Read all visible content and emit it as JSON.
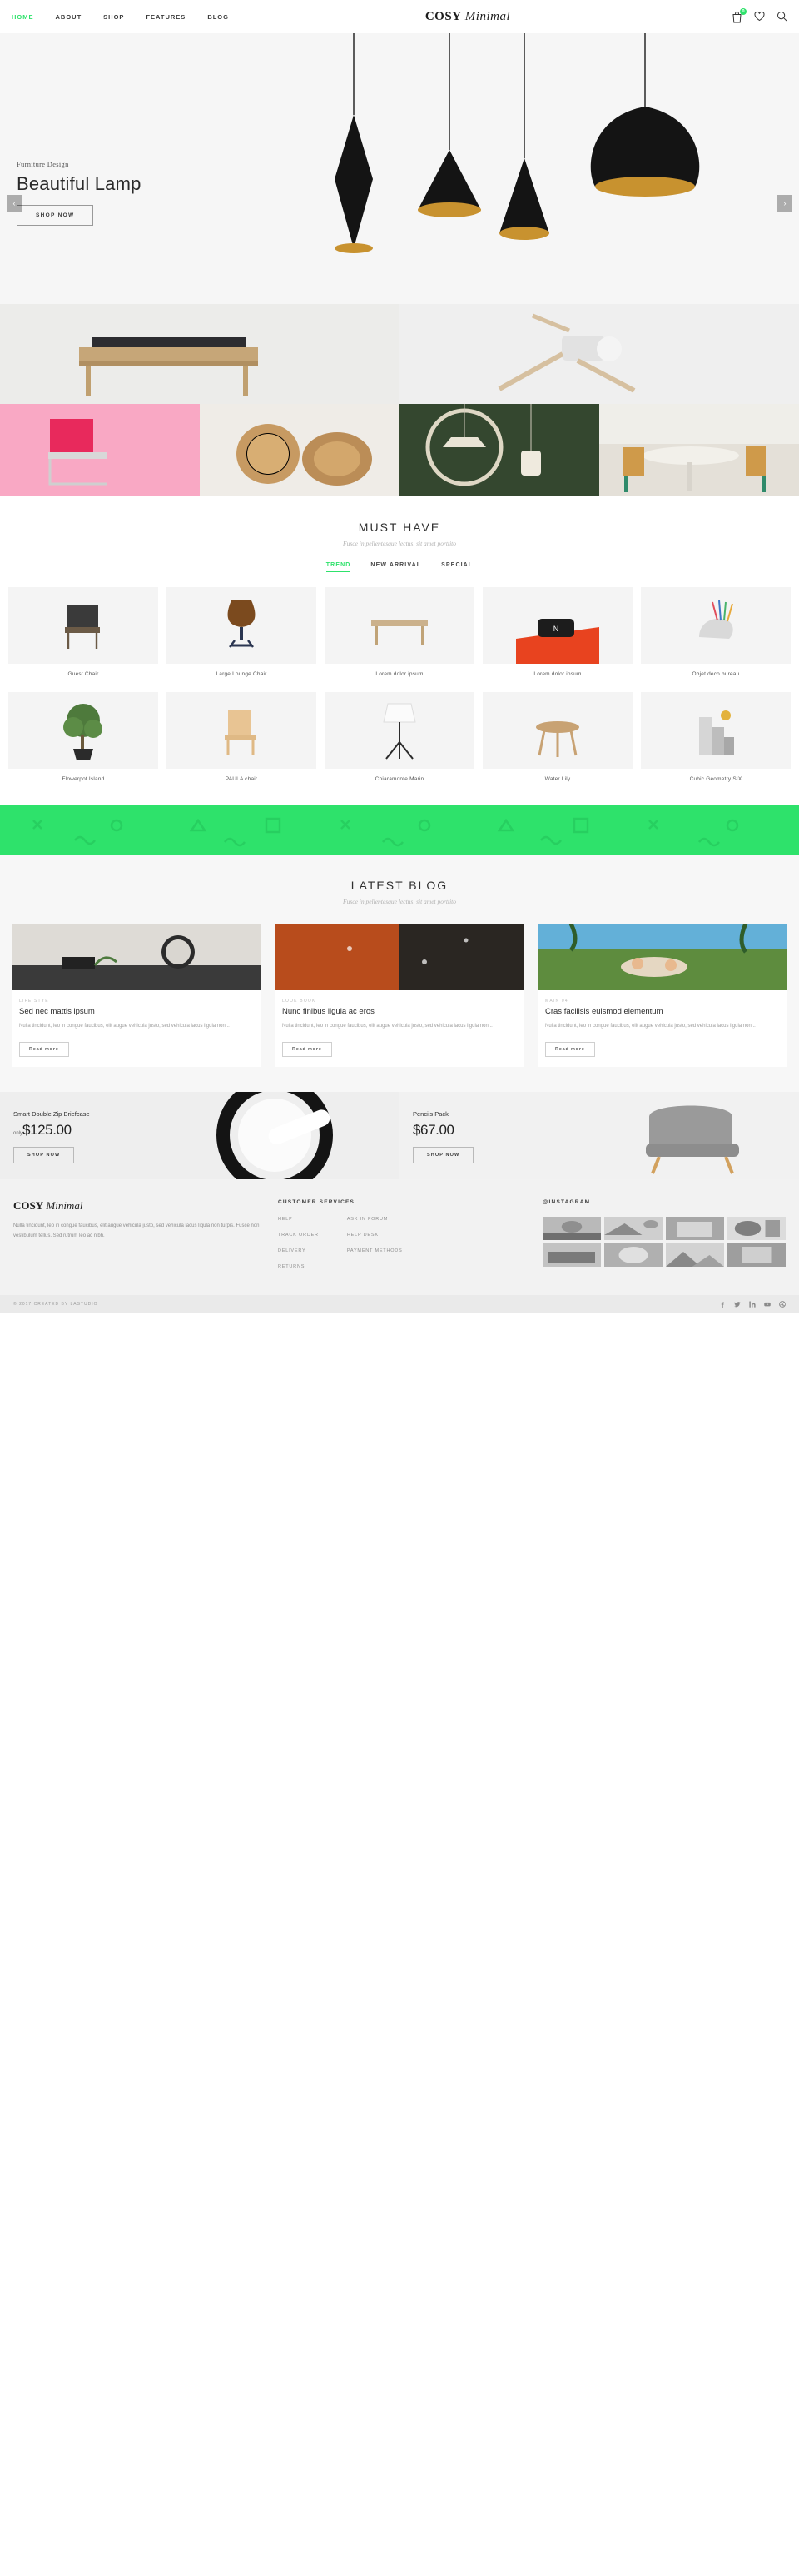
{
  "header": {
    "nav": [
      {
        "label": "HOME",
        "active": true
      },
      {
        "label": "ABOUT",
        "active": false
      },
      {
        "label": "SHOP",
        "active": false
      },
      {
        "label": "FEATURES",
        "active": false
      },
      {
        "label": "BLOG",
        "active": false
      }
    ],
    "logo_bold": "COSY",
    "logo_italic": "Minimal",
    "cart_count": "0",
    "icons": [
      "cart-icon",
      "wishlist-heart-icon",
      "search-icon"
    ]
  },
  "hero": {
    "eyebrow": "Furniture Design",
    "title": "Beautiful Lamp",
    "cta": "SHOP NOW",
    "prev": "‹",
    "next": "›"
  },
  "must_have": {
    "title": "MUST HAVE",
    "subtitle": "Fusce in pellentesque lectus, sit amet porttito",
    "tabs": [
      {
        "label": "TREND",
        "active": true
      },
      {
        "label": "NEW ARRIVAL",
        "active": false
      },
      {
        "label": "SPECIAL",
        "active": false
      }
    ],
    "products": [
      {
        "name": "Guest Chair"
      },
      {
        "name": "Large Lounge Chair"
      },
      {
        "name": "Lorem dolor ipsum"
      },
      {
        "name": "Lorem dolor ipsum"
      },
      {
        "name": "Objet deco bureau"
      },
      {
        "name": "Flowerpot Island"
      },
      {
        "name": "PAULA chair"
      },
      {
        "name": "Chiaramonte Marin"
      },
      {
        "name": "Water Lily"
      },
      {
        "name": "Cubic Geometry SIX"
      }
    ]
  },
  "blog": {
    "title": "LATEST BLOG",
    "subtitle": "Fusce in pellentesque lectus, sit amet porttito",
    "read_more": "Read more",
    "posts": [
      {
        "category": "LIFE STYE",
        "title": "Sed nec mattis ipsum",
        "excerpt": "Nulla tincidunt, leo in congue faucibus, elit augue vehicula justo, sed vehicula lacus ligula non..."
      },
      {
        "category": "LOOK BOOK",
        "title": "Nunc finibus ligula ac eros",
        "excerpt": "Nulla tincidunt, leo in congue faucibus, elit augue vehicula justo, sed vehicula lacus ligula non..."
      },
      {
        "category": "MAIN 04",
        "title": "Cras facilisis euismod elementum",
        "excerpt": "Nulla tincidunt, leo in congue faucibus, elit augue vehicula justo, sed vehicula lacus ligula non..."
      }
    ]
  },
  "promos": [
    {
      "name": "Smart Double Zip Briefcase",
      "only": "only",
      "price": "$125.00",
      "cta": "SHOP NOW"
    },
    {
      "name": "Pencils Pack",
      "only": "",
      "price": "$67.00",
      "cta": "SHOP NOW"
    }
  ],
  "footer": {
    "logo_bold": "COSY",
    "logo_italic": "Minimal",
    "about": "Nulla tincidunt, leo in congue faucibus, elit augue vehicula justo, sed vehicula lacus ligula non turpis. Fusce non vestibulum tellus. Sed rutrum leo ac nibh.",
    "services_head": "CUSTOMER SERVICES",
    "services_col1": [
      "HELP",
      "TRACK ORDER",
      "DELIVERY",
      "RETURNS"
    ],
    "services_col2": [
      "ASK IN FORUM",
      "HELP DESK",
      "PAYMENT METHODS"
    ],
    "instagram_head": "@INSTAGRAM",
    "instagram_count": 8,
    "copyright": "© 2017 CREATED BY LASTUDIO",
    "socials": [
      "facebook-icon",
      "twitter-icon",
      "linkedin-icon",
      "youtube-icon",
      "dribbble-icon"
    ]
  },
  "colors": {
    "accent_green": "#2ee26b",
    "text_dark": "#2b2b2b",
    "text_muted": "#9c9c9c",
    "hero_bg": "#f6f6f6"
  }
}
